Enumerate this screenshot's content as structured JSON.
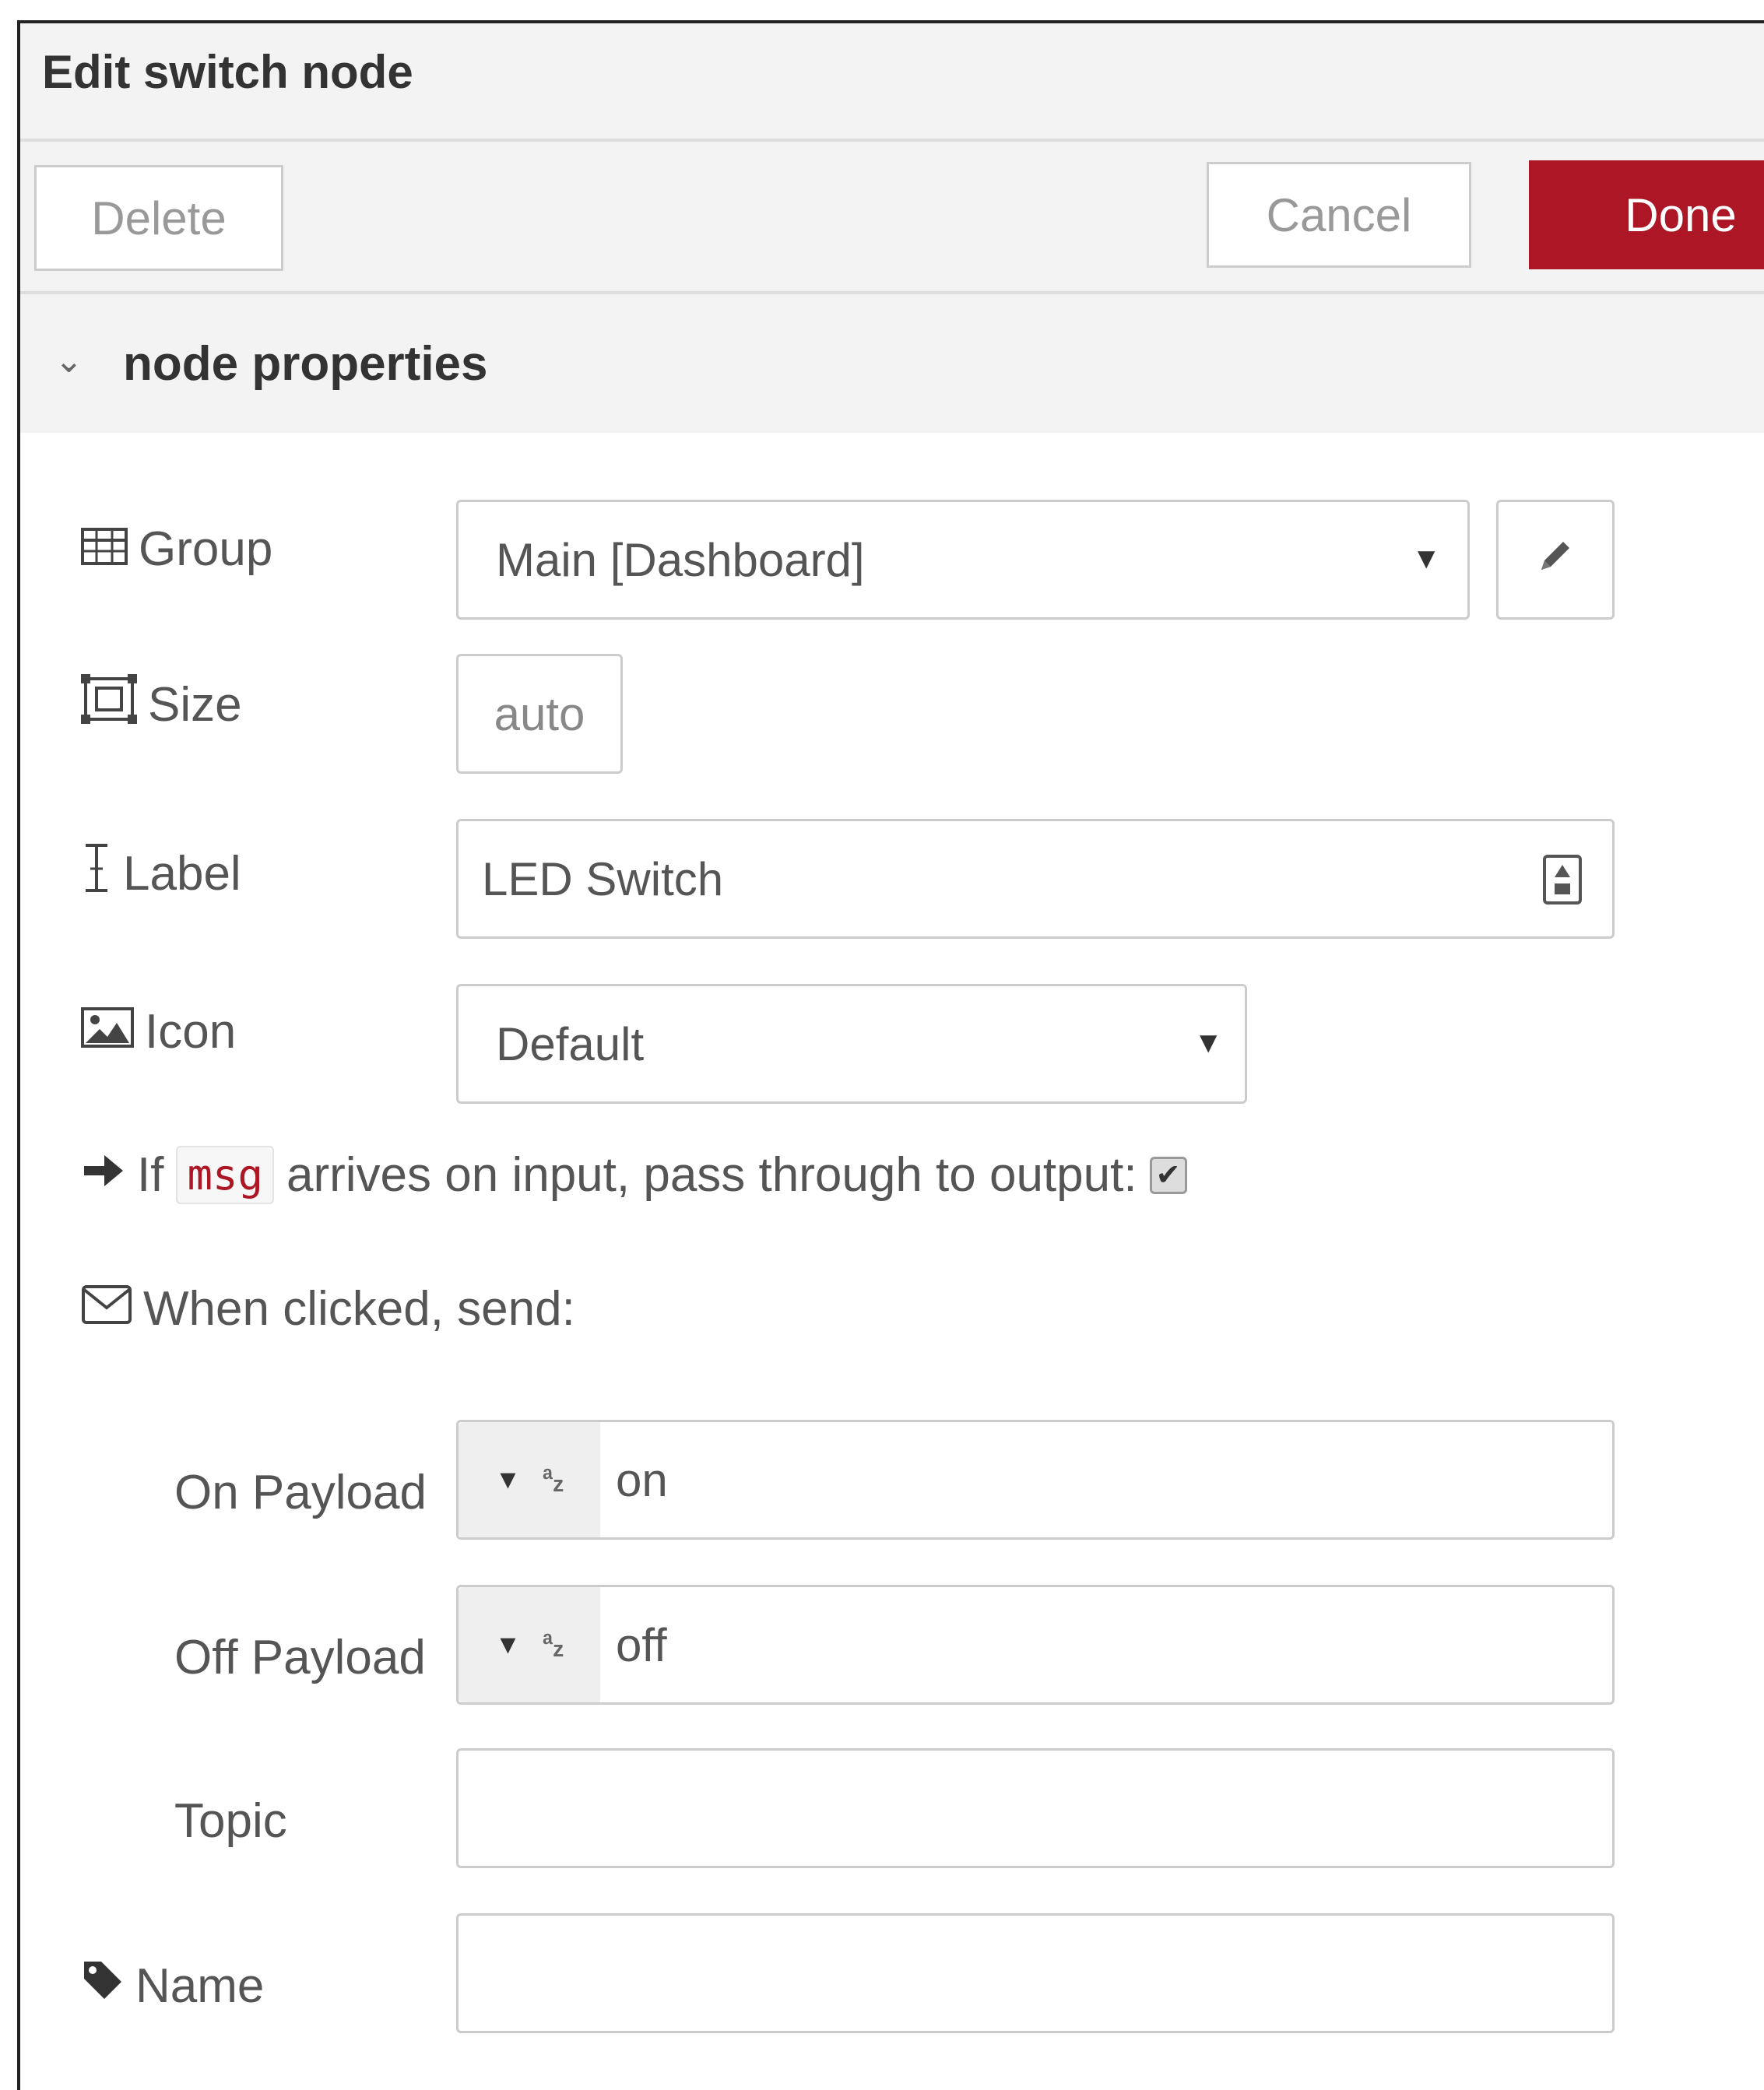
{
  "dialog": {
    "title": "Edit switch node",
    "buttons": {
      "delete": "Delete",
      "cancel": "Cancel",
      "done": "Done"
    },
    "section": {
      "label": "node properties",
      "expanded": true
    }
  },
  "form": {
    "group": {
      "label": "Group",
      "value": "Main [Dashboard]",
      "icon": "table-icon"
    },
    "size": {
      "label": "Size",
      "value": "auto",
      "icon": "resize-icon"
    },
    "label": {
      "label": "Label",
      "value": "LED Switch",
      "icon": "text-cursor-icon"
    },
    "icon": {
      "label": "Icon",
      "value": "Default",
      "icon": "image-icon"
    },
    "passthrough": {
      "prefix": "If",
      "code": "msg",
      "suffix": "arrives on input, pass through to output:",
      "checked": true
    },
    "when_clicked": {
      "label": "When clicked, send:",
      "icon": "envelope-icon"
    },
    "on_payload": {
      "label": "On Payload",
      "value": "on",
      "type_icon": "string-type-icon"
    },
    "off_payload": {
      "label": "Off Payload",
      "value": "off",
      "type_icon": "string-type-icon"
    },
    "topic": {
      "label": "Topic",
      "value": ""
    },
    "name": {
      "label": "Name",
      "value": "",
      "icon": "tag-icon"
    }
  },
  "colors": {
    "accent": "#ad1625",
    "panel": "#f3f3f3"
  }
}
